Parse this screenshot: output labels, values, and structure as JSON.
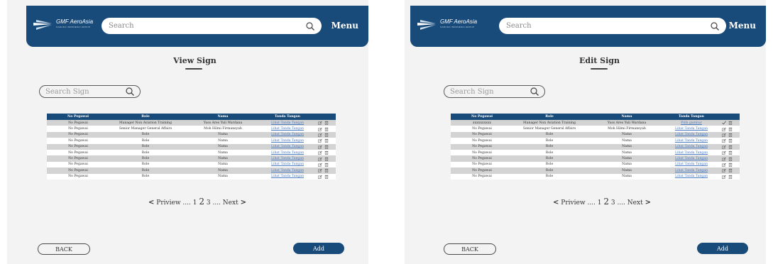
{
  "colors": {
    "brand": "#184a7a",
    "row_alt": "#d3d3d3",
    "link": "#4a7cc4"
  },
  "icons": {
    "search": "search-icon",
    "edit": "edit-icon",
    "delete": "trash-icon",
    "confirm": "check-icon"
  },
  "left": {
    "header": {
      "logo": "GMF AeroAsia",
      "logo_tag": "GARUDA INDONESIA GROUP",
      "search_placeholder": "Search",
      "menu": "Menu"
    },
    "title": "View Sign",
    "sign_search_placeholder": "Search Sign",
    "table": {
      "columns": [
        "No Pegawai",
        "Role",
        "Nama",
        "Tanda Tangan",
        ""
      ],
      "rows": [
        [
          "No Pegawai",
          "Manager Non Aviation Training",
          "Yuss Ares Yuli Wardana",
          "Lihat Tanda Tangan"
        ],
        [
          "No Pegawai",
          "Senior Manager General Affairs",
          "Moh Hilmi Firmansyah",
          "Lihat Tanda Tangan"
        ],
        [
          "No Pegawai",
          "Role",
          "Nama",
          "Lihat Tanda Tangan"
        ],
        [
          "No Pegawai",
          "Role",
          "Nama",
          "Lihat Tanda Tangan"
        ],
        [
          "No Pegawai",
          "Role",
          "Nama",
          "Lihat Tanda Tangan"
        ],
        [
          "No Pegawai",
          "Role",
          "Nama",
          "Lihat Tanda Tangan"
        ],
        [
          "No Pegawai",
          "Role",
          "Nama",
          "Lihat Tanda Tangan"
        ],
        [
          "No Pegawai",
          "Role",
          "Nama",
          "Lihat Tanda Tangan"
        ],
        [
          "No Pegawai",
          "Role",
          "Nama",
          "Lihat Tanda Tangan"
        ],
        [
          "No Pegawai",
          "Role",
          "Nama",
          "Lihat Tanda Tangan"
        ]
      ]
    },
    "pager": {
      "prev": "Priview",
      "dots": "....",
      "p1": "1",
      "p2": "2",
      "p3": "3",
      "next": "Next"
    },
    "back": "BACK",
    "add": "Add"
  },
  "right": {
    "header": {
      "logo": "GMF AeroAsia",
      "logo_tag": "GARUDA INDONESIA GROUP",
      "search_placeholder": "Search",
      "menu": "Menu"
    },
    "title": "Edit Sign",
    "sign_search_placeholder": "Search Sign",
    "table": {
      "columns": [
        "No Pegawai",
        "Role",
        "Nama",
        "Tanda Tangan",
        ""
      ],
      "rows": [
        [
          "xxxxxxxxxx",
          "Manager Non Aviation Training",
          "Yuss Ares Yuli Wardana",
          "Pilih gambar"
        ],
        [
          "No Pegawai",
          "Senior Manager General Affairs",
          "Moh Hilmi Firmansyah",
          "Lihat Tanda Tangan"
        ],
        [
          "No Pegawai",
          "Role",
          "Nama",
          "Lihat Tanda Tangan"
        ],
        [
          "No Pegawai",
          "Role",
          "Nama",
          "Lihat Tanda Tangan"
        ],
        [
          "No Pegawai",
          "Role",
          "Nama",
          "Lihat Tanda Tangan"
        ],
        [
          "No Pegawai",
          "Role",
          "Nama",
          "Lihat Tanda Tangan"
        ],
        [
          "No Pegawai",
          "Role",
          "Nama",
          "Lihat Tanda Tangan"
        ],
        [
          "No Pegawai",
          "Role",
          "Nama",
          "Lihat Tanda Tangan"
        ],
        [
          "No Pegawai",
          "Role",
          "Nama",
          "Lihat Tanda Tangan"
        ],
        [
          "No Pegawai",
          "Role",
          "Nama",
          "Lihat Tanda Tangan"
        ]
      ]
    },
    "pager": {
      "prev": "Priview",
      "dots": "....",
      "p1": "1",
      "p2": "2",
      "p3": "3",
      "next": "Next"
    },
    "back": "BACK",
    "add": "Add"
  }
}
